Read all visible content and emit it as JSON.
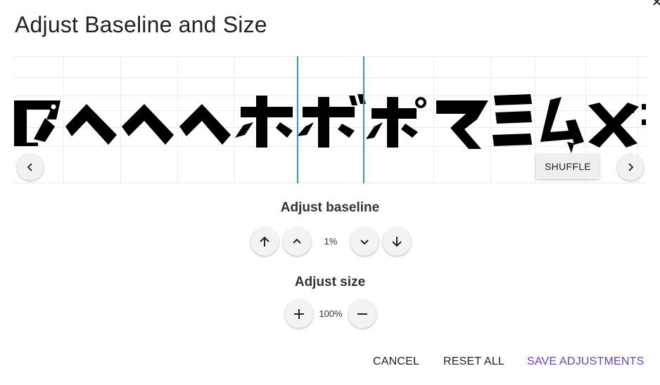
{
  "dialog": {
    "title": "Adjust Baseline and Size",
    "close_icon": "close-icon"
  },
  "preview": {
    "glyphs": [
      "プ",
      "ヘ",
      "ヘ",
      "ヘ",
      "ホ",
      "ボ",
      "ポ",
      "マ",
      "ミ",
      "ム",
      "x"
    ],
    "shuffle_label": "SHUFFLE",
    "prev_icon": "chevron-left-icon",
    "next_icon": "chevron-right-icon",
    "guide_color": "#1aa5c8"
  },
  "baseline": {
    "label": "Adjust baseline",
    "value": "1%",
    "icons": [
      "arrow-up-icon",
      "chevron-up-icon",
      "chevron-down-icon",
      "arrow-down-icon"
    ]
  },
  "size": {
    "label": "Adjust size",
    "value": "100%",
    "icons": [
      "plus-icon",
      "minus-icon"
    ]
  },
  "actions": {
    "cancel": "CANCEL",
    "reset_all": "RESET ALL",
    "save": "SAVE ADJUSTMENTS",
    "accent_color": "#6a3fc4"
  }
}
